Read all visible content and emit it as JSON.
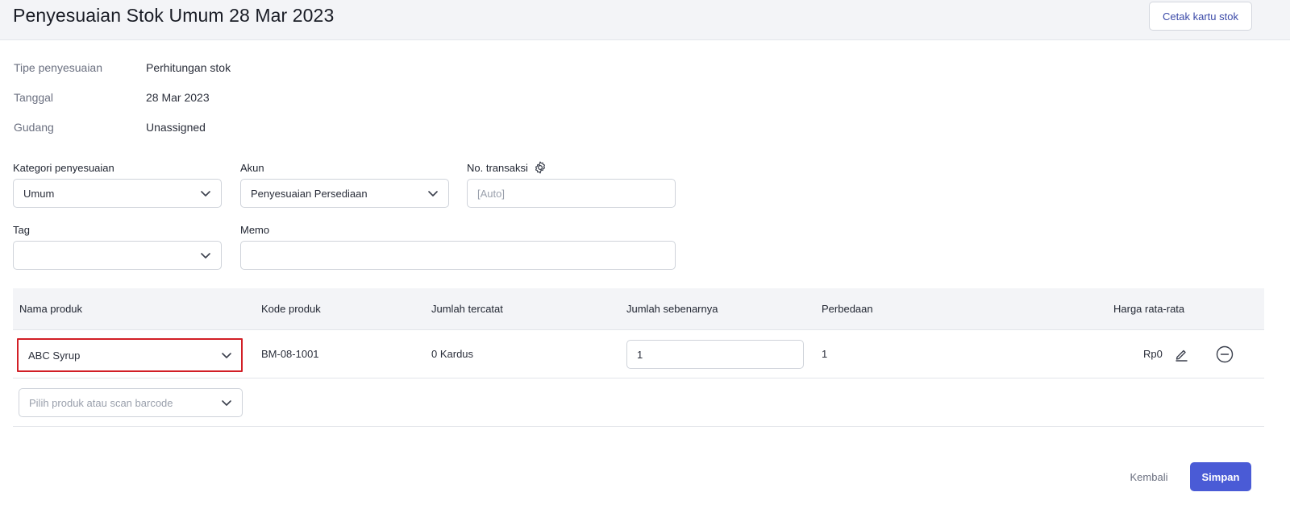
{
  "header": {
    "title": "Penyesuaian Stok Umum 28 Mar 2023",
    "print_button": "Cetak kartu stok"
  },
  "info": [
    {
      "label": "Tipe penyesuaian",
      "value": "Perhitungan stok"
    },
    {
      "label": "Tanggal",
      "value": "28 Mar 2023"
    },
    {
      "label": "Gudang",
      "value": "Unassigned"
    }
  ],
  "form": {
    "category": {
      "label": "Kategori penyesuaian",
      "value": "Umum"
    },
    "account": {
      "label": "Akun",
      "value": "Penyesuaian Persediaan"
    },
    "transaction_no": {
      "label": "No. transaksi",
      "placeholder": "[Auto]"
    },
    "tag": {
      "label": "Tag",
      "value": ""
    },
    "memo": {
      "label": "Memo",
      "value": ""
    }
  },
  "table": {
    "columns": [
      "Nama produk",
      "Kode produk",
      "Jumlah tercatat",
      "Jumlah sebenarnya",
      "Perbedaan",
      "Harga rata-rata"
    ],
    "rows": [
      {
        "product": "ABC Syrup",
        "code": "BM-08-1001",
        "recorded": "0 Kardus",
        "actual": "1",
        "difference": "1",
        "avg_price": "Rp0"
      }
    ],
    "new_row_placeholder": "Pilih produk atau scan barcode"
  },
  "footer": {
    "back": "Kembali",
    "save": "Simpan"
  },
  "colors": {
    "primary": "#4a5bd6",
    "highlight": "#d21f26",
    "header_bg": "#f3f4f7"
  },
  "icons": [
    "chevron-down-icon",
    "gear-icon",
    "pencil-icon",
    "minus-circle-icon"
  ]
}
